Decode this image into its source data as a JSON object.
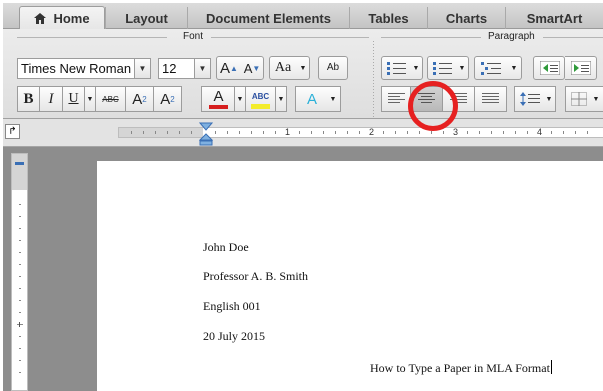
{
  "tabs": [
    {
      "label": "Home",
      "active": true
    },
    {
      "label": "Layout"
    },
    {
      "label": "Document Elements"
    },
    {
      "label": "Tables"
    },
    {
      "label": "Charts"
    },
    {
      "label": "SmartArt"
    }
  ],
  "ribbon": {
    "font_group_label": "Font",
    "paragraph_group_label": "Paragraph",
    "font_name": "Times New Roman",
    "font_size": "12",
    "grow_font": "A",
    "shrink_font": "A",
    "change_case": "Aa",
    "spelling_label": "Ab",
    "bold": "B",
    "italic": "I",
    "underline": "U",
    "strikethrough": "ABC",
    "superscript": "A",
    "superscript_mark": "2",
    "subscript": "A",
    "subscript_mark": "2",
    "font_color": "A",
    "highlight": "ABC",
    "text_effects": "A",
    "selected_alignment": "center"
  },
  "ruler": {
    "numbers": [
      "1",
      "2",
      "3",
      "4"
    ]
  },
  "document": {
    "lines": [
      "John Doe",
      "Professor A. B. Smith",
      "English 001",
      "20 July 2015",
      "How to Type a Paper in MLA Format"
    ]
  },
  "colors": {
    "highlight_ring": "#e62020",
    "font_color_bar": "#d61e1e",
    "highlight_bar": "#f3ec2c"
  }
}
